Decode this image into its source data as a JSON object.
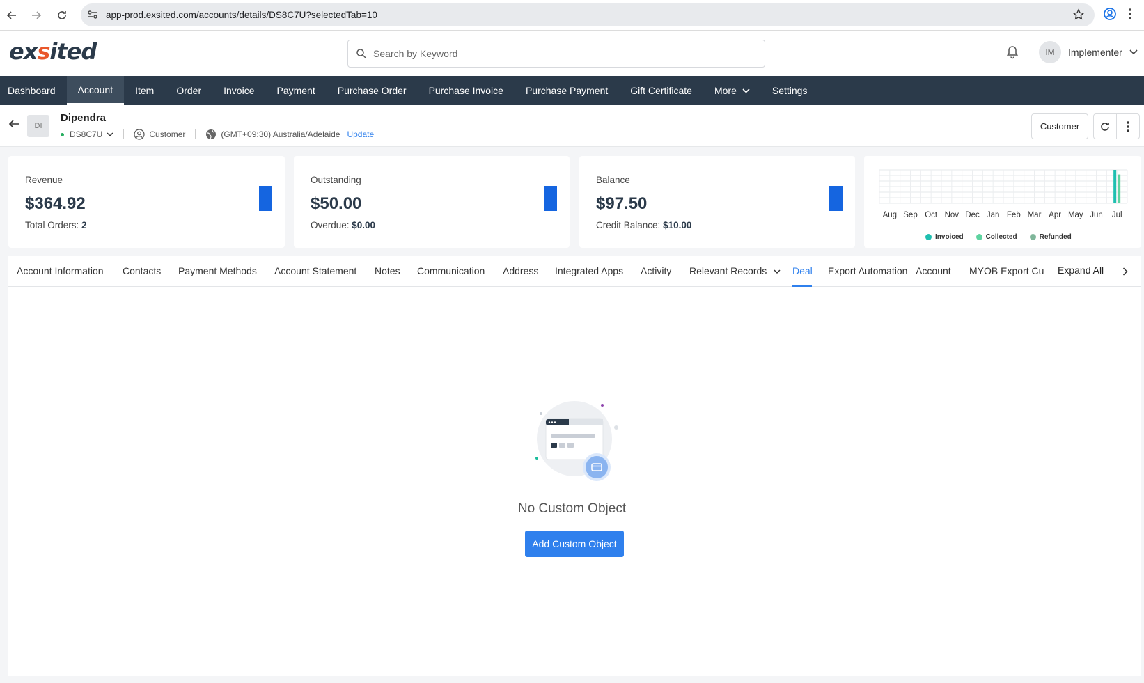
{
  "browser": {
    "url": "app-prod.exsited.com/accounts/details/DS8C7U?selectedTab=10"
  },
  "header": {
    "logo": {
      "pre": "ex",
      "mark": "s",
      "post": "ited"
    },
    "search_placeholder": "Search by Keyword",
    "user_initials": "IM",
    "user_name": "Implementer"
  },
  "nav": {
    "items": [
      "Dashboard",
      "Account",
      "Item",
      "Order",
      "Invoice",
      "Payment",
      "Purchase Order",
      "Purchase Invoice",
      "Purchase Payment",
      "Gift Certificate",
      "More",
      "Settings"
    ],
    "active": "Account"
  },
  "account": {
    "initials": "DI",
    "name": "Dipendra",
    "id": "DS8C7U",
    "type": "Customer",
    "timezone": "(GMT+09:30) Australia/Adelaide",
    "update_label": "Update",
    "type_button": "Customer"
  },
  "cards": {
    "revenue": {
      "label": "Revenue",
      "amount": "$364.92",
      "sub_label": "Total Orders: ",
      "sub_value": "2"
    },
    "outstanding": {
      "label": "Outstanding",
      "amount": "$50.00",
      "sub_label": "Overdue: ",
      "sub_value": "$0.00"
    },
    "balance": {
      "label": "Balance",
      "amount": "$97.50",
      "sub_label": "Credit Balance: ",
      "sub_value": "$10.00"
    }
  },
  "colors": {
    "nav_bg": "#2b3a4a",
    "accent": "#2f80ed",
    "card_bar": "#1565e0",
    "invoiced": "#1fbfb0",
    "collected": "#5ed3a0",
    "refunded": "#7fb69a"
  },
  "chart_data": {
    "type": "bar",
    "categories": [
      "Aug",
      "Sep",
      "Oct",
      "Nov",
      "Dec",
      "Jan",
      "Feb",
      "Mar",
      "Apr",
      "May",
      "Jun",
      "Jul"
    ],
    "series": [
      {
        "name": "Invoiced",
        "values": [
          0,
          0,
          0,
          0,
          0,
          0,
          0,
          0,
          0,
          0,
          0,
          364.92
        ]
      },
      {
        "name": "Collected",
        "values": [
          0,
          0,
          0,
          0,
          0,
          0,
          0,
          0,
          0,
          0,
          0,
          314.92
        ]
      },
      {
        "name": "Refunded",
        "values": [
          0,
          0,
          0,
          0,
          0,
          0,
          0,
          0,
          0,
          0,
          0,
          0
        ]
      }
    ],
    "grid": true,
    "legend": "bottom"
  },
  "tabs": {
    "items": [
      "Account Information",
      "Contacts",
      "Payment Methods",
      "Account Statement",
      "Notes",
      "Communication",
      "Address",
      "Integrated Apps",
      "Activity",
      "Relevant Records",
      "Deal",
      "Export Automation _Account",
      "MYOB Export Cus"
    ],
    "active": "Deal",
    "expand_all": "Expand All"
  },
  "empty": {
    "title": "No Custom Object",
    "button": "Add Custom Object"
  }
}
